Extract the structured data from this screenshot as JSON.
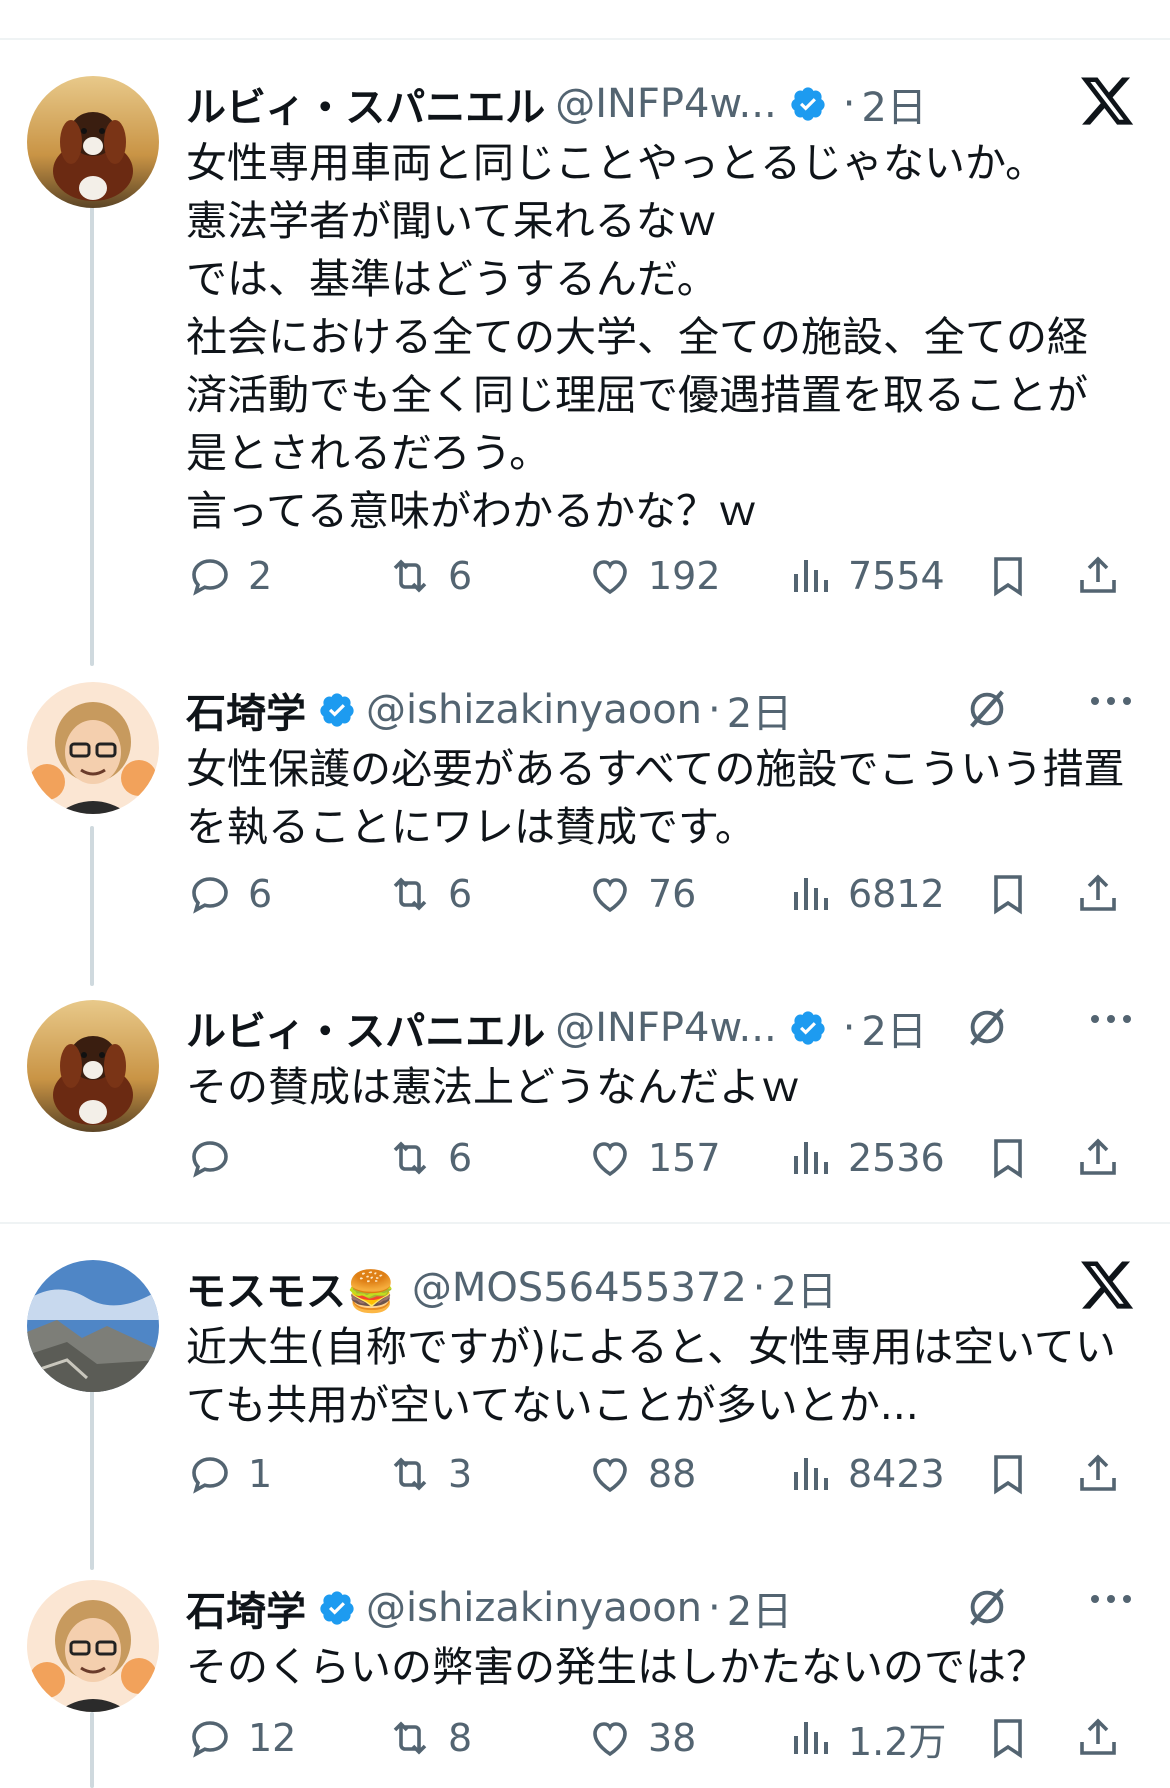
{
  "tweets": [
    {
      "name": "ルビィ・スパニエル",
      "handle": "@INFP4w...",
      "time": "2日",
      "text": "女性専用車両と同じことやっとるじゃないか。\n憲法学者が聞いて呆れるなｗ\nでは、基準はどうするんだ。\n社会における全ての大学、全ての施設、全ての経済活動でも全く同じ理屈で優遇措置を取ることが是とされるだろう。\n言ってる意味がわかるかな？ｗ",
      "replies": "2",
      "retweets": "6",
      "likes": "192",
      "views": "7554",
      "corner_icon": "x-logo-icon",
      "avatar": "dog-avatar"
    },
    {
      "name": "石埼学",
      "handle": "@ishizakinyaoon",
      "time": "2日",
      "text": "女性保護の必要があるすべての施設でこういう措置を執ることにワレは賛成です。",
      "replies": "6",
      "retweets": "6",
      "likes": "76",
      "views": "6812",
      "corner_icon": "grok-icon",
      "avatar": "illustrated-man-avatar"
    },
    {
      "name": "ルビィ・スパニエル",
      "handle": "@INFP4w...",
      "time": "2日",
      "text": "その賛成は憲法上どうなんだよｗ",
      "replies": "",
      "retweets": "6",
      "likes": "157",
      "views": "2536",
      "corner_icon": "grok-icon",
      "avatar": "dog-avatar"
    },
    {
      "name": "モスモス🍔",
      "handle": "@MOS56455372",
      "time": "2日",
      "text": "近大生(自称ですが)によると、女性専用は空いていても共用が空いてないことが多いとか...",
      "replies": "1",
      "retweets": "3",
      "likes": "88",
      "views": "8423",
      "corner_icon": "x-logo-icon",
      "avatar": "mountain-avatar"
    },
    {
      "name": "石埼学",
      "handle": "@ishizakinyaoon",
      "time": "2日",
      "text": "そのくらいの弊害の発生はしかたないのでは？",
      "replies": "12",
      "retweets": "8",
      "likes": "38",
      "views": "1.2万",
      "corner_icon": "grok-icon",
      "avatar": "illustrated-man-avatar"
    }
  ],
  "colors": {
    "verified": "#1d9bf0",
    "secondary_text": "#536471",
    "thread_line": "#cfd9de"
  }
}
